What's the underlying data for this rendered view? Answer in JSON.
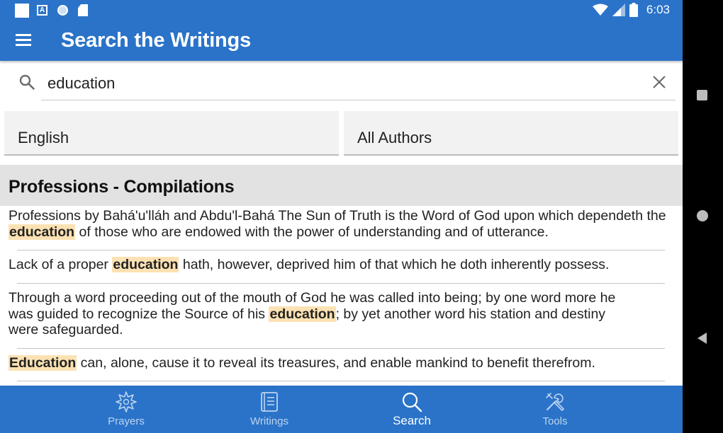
{
  "status_bar": {
    "time": "6:03",
    "left_icons": [
      "square-icon",
      "a-icon",
      "circle-icon",
      "sd-card-icon"
    ],
    "right_icons": [
      "wifi-icon",
      "signal-icon",
      "battery-icon"
    ]
  },
  "app_bar": {
    "title": "Search the Writings",
    "menu_icon": "hamburger-menu-icon"
  },
  "search": {
    "value": "education",
    "search_icon": "search-icon",
    "clear_icon": "close-icon"
  },
  "filters": {
    "language": "English",
    "author": "All Authors"
  },
  "results": {
    "title": "Professions - Compilations",
    "snippets": [
      {
        "before": "Professions by Bahá'u'lláh and Abdu'l-Bahá The Sun of Truth is the Word of God upon which dependeth the ",
        "match": "education",
        "after": " of those who are endowed with the power of understanding and of utterance."
      },
      {
        "before": "Lack of a proper ",
        "match": "education",
        "after": " hath, however, deprived him of that which he doth inherently possess."
      },
      {
        "before": "Through a word proceeding out of the mouth of God he was called into being; by one word more he was guided to recognize the Source of his ",
        "match": "education",
        "after": "; by yet another word his station and destiny were safeguarded."
      },
      {
        "before": "",
        "match": "Education",
        "after": " can, alone, cause it to reveal its treasures, and enable mankind to benefit therefrom."
      }
    ]
  },
  "bottom_nav": {
    "items": [
      {
        "label": "Prayers",
        "icon": "star-burst-icon"
      },
      {
        "label": "Writings",
        "icon": "book-icon"
      },
      {
        "label": "Search",
        "icon": "search-icon"
      },
      {
        "label": "Tools",
        "icon": "tools-icon"
      }
    ],
    "active": "Search"
  },
  "colors": {
    "primary": "#2a73c9",
    "highlight": "#fce2b3",
    "header_bg": "#e2e2e2"
  }
}
